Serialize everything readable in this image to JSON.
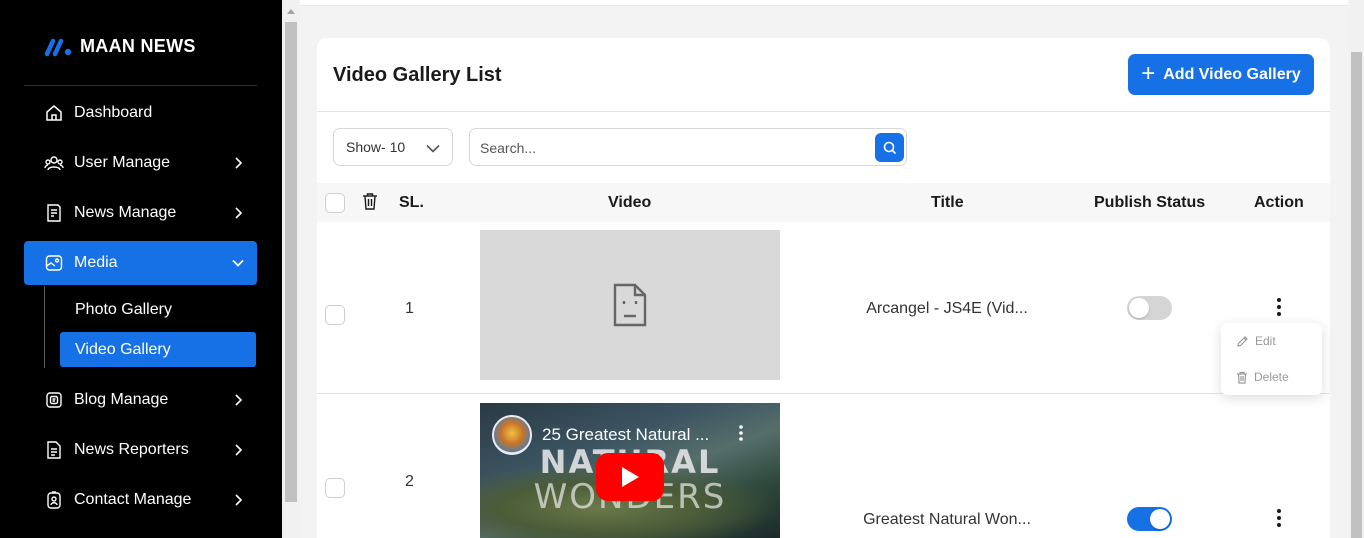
{
  "brand": {
    "name": "MAAN NEWS",
    "accent": "#1771e6"
  },
  "sidebar": {
    "items": [
      {
        "label": "Dashboard",
        "icon": "home-icon"
      },
      {
        "label": "User Manage",
        "icon": "users-icon"
      },
      {
        "label": "News Manage",
        "icon": "news-icon"
      },
      {
        "label": "Media",
        "icon": "media-icon",
        "active": true,
        "expanded": true
      },
      {
        "label": "Blog Manage",
        "icon": "blog-icon"
      },
      {
        "label": "News Reporters",
        "icon": "document-icon"
      },
      {
        "label": "Contact Manage",
        "icon": "contact-icon"
      }
    ],
    "media_sub": [
      {
        "label": "Photo Gallery"
      },
      {
        "label": "Video Gallery",
        "active": true
      }
    ]
  },
  "page": {
    "title": "Video Gallery List",
    "add_button": "Add Video Gallery"
  },
  "filters": {
    "show_value": "Show- 10",
    "search_placeholder": "Search..."
  },
  "table": {
    "headers": {
      "sl": "SL.",
      "video": "Video",
      "title": "Title",
      "status": "Publish Status",
      "action": "Action"
    },
    "rows": [
      {
        "sl": "1",
        "video_type": "broken",
        "title": "Arcangel - JS4E (Vid...",
        "published": false
      },
      {
        "sl": "2",
        "video_type": "youtube",
        "video_title": "25 Greatest Natural ...",
        "thumb_text_1": "NATURAL",
        "thumb_text_2": "WONDERS",
        "title": "Greatest Natural Won...",
        "published": true
      }
    ]
  },
  "action_menu": {
    "edit": "Edit",
    "delete": "Delete"
  }
}
